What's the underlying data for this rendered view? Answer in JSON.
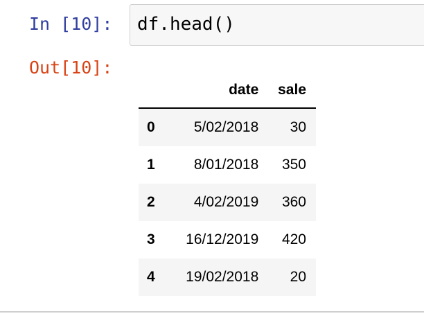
{
  "cell": {
    "input_prompt": "In [10]:",
    "code": "df.head()",
    "output_prompt": "Out[10]:"
  },
  "dataframe": {
    "columns": [
      "date",
      "sale"
    ],
    "rows": [
      {
        "index": "0",
        "date": "5/02/2018",
        "sale": "30"
      },
      {
        "index": "1",
        "date": "8/01/2018",
        "sale": "350"
      },
      {
        "index": "2",
        "date": "4/02/2019",
        "sale": "360"
      },
      {
        "index": "3",
        "date": "16/12/2019",
        "sale": "420"
      },
      {
        "index": "4",
        "date": "19/02/2018",
        "sale": "20"
      }
    ]
  }
}
